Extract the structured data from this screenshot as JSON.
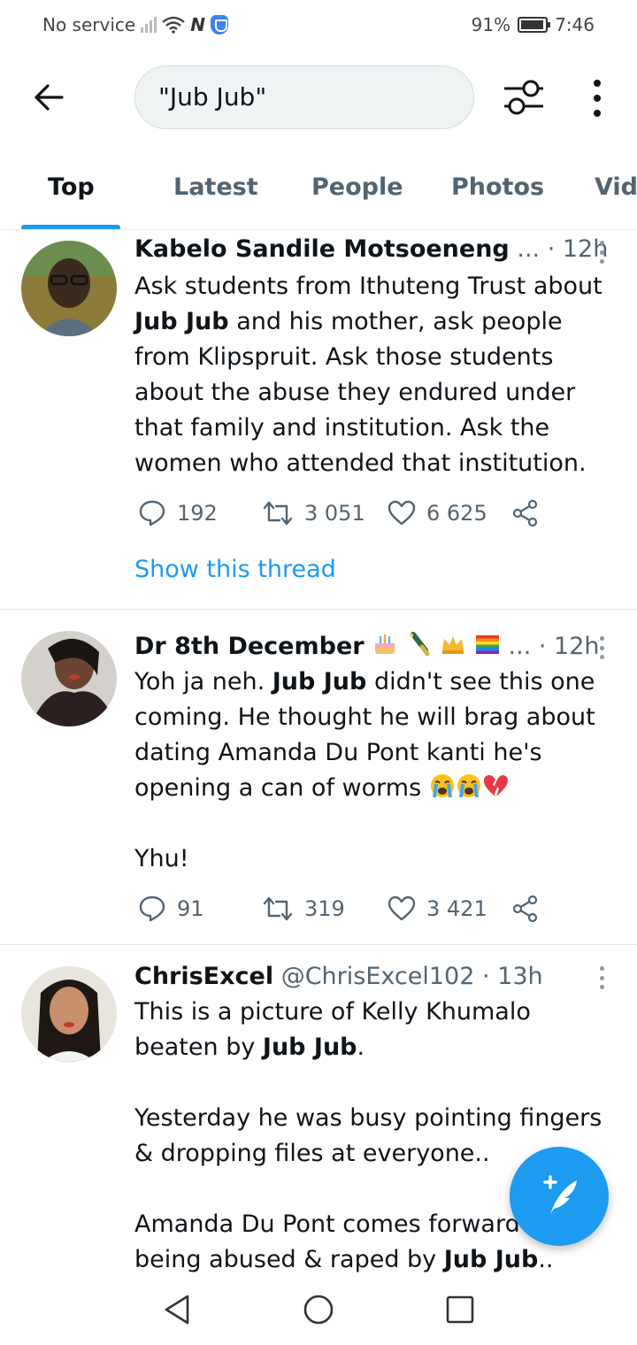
{
  "status_bar": {
    "carrier": "No service",
    "nfc": "N",
    "battery": "91%",
    "time": "7:46"
  },
  "search": {
    "query": "\"Jub Jub\""
  },
  "tabs": [
    {
      "label": "Top",
      "active": true
    },
    {
      "label": "Latest"
    },
    {
      "label": "People"
    },
    {
      "label": "Photos"
    },
    {
      "label": "Vide"
    }
  ],
  "tweets": [
    {
      "name": "Kabelo Sandile Motsoeneng",
      "handle": "...",
      "time": "· 12h",
      "text_parts": [
        "Ask students from Ithuteng Trust about",
        "Jub Jub",
        "and his mother, ask people from Klipspruit. Ask those students about the abuse they endured under that family and institution. Ask the women who attended that institution."
      ],
      "replies": "192",
      "retweets": "3 051",
      "likes": "6 625",
      "show_thread": "Show this thread"
    },
    {
      "name": "Dr 8th December",
      "handle": "...",
      "time": "· 12h",
      "text_parts": [
        "Yoh ja neh.",
        "Jub Jub",
        "didn't see this one coming. He thought he will brag about dating Amanda Du Pont kanti he's opening a can of worms",
        "Yhu!"
      ],
      "replies": "91",
      "retweets": "319",
      "likes": "3 421"
    },
    {
      "name": "ChrisExcel",
      "handle": "@ChrisExcel102",
      "time": "· 13h",
      "text_parts": [
        "This is a picture of Kelly Khumalo beaten by",
        "Jub Jub",
        ".",
        "Yesterday he was busy pointing fingers & dropping files at everyone..",
        "Amanda Du Pont comes forward",
        "being abused & raped by",
        "Jub Jub",
        ".."
      ]
    }
  ],
  "colors": {
    "accent": "#1d9bf0",
    "text": "#0f1419",
    "secondary": "#536471"
  },
  "icons": [
    "back-arrow-icon",
    "filter-icon",
    "more-vert-icon",
    "reply-icon",
    "retweet-icon",
    "like-icon",
    "share-icon",
    "compose-icon",
    "nav-back-icon",
    "nav-home-icon",
    "nav-recents-icon"
  ]
}
